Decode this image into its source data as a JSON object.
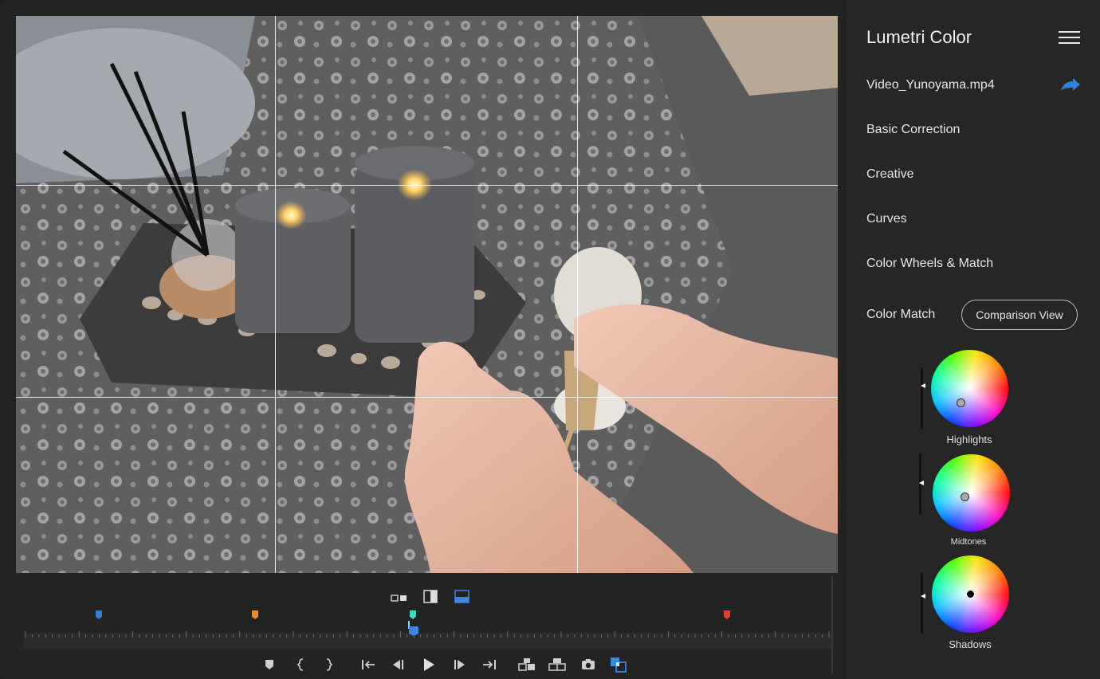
{
  "panel": {
    "title": "Lumetri Color",
    "file_name": "Video_Yunoyama.mp4",
    "sections": [
      "Basic Correction",
      "Creative",
      "Curves",
      "Color Wheels & Match"
    ],
    "color_match_label": "Color Match",
    "comparison_button": "Comparison View"
  },
  "wheels": [
    {
      "label": "Highlights"
    },
    {
      "label": "Midtones"
    },
    {
      "label": "Shadows"
    }
  ],
  "timeline": {
    "markers": [
      {
        "color": "#2e7fd6"
      },
      {
        "color": "#f08a24"
      },
      {
        "color": "#3fd9c7"
      },
      {
        "color": "#e8402a"
      }
    ],
    "playhead_color": "#3a86e0"
  },
  "icons": {
    "menu": "hamburger-icon",
    "share": "share-arrow-icon",
    "view_modes": [
      "side-by-side-view-icon",
      "split-view-icon",
      "top-bottom-view-icon"
    ],
    "transport": [
      "add-marker-icon",
      "mark-in-icon",
      "mark-out-icon",
      "go-to-in-icon",
      "step-back-icon",
      "play-icon",
      "step-forward-icon",
      "go-to-out-icon",
      "insert-icon",
      "overwrite-icon",
      "export-frame-icon",
      "comparison-toggle-icon"
    ]
  },
  "colors": {
    "accent": "#2e7fd6"
  }
}
